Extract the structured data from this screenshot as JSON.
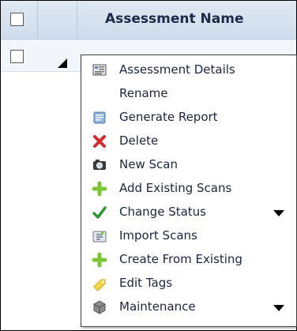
{
  "grid": {
    "header": {
      "column_name": "Assessment Name"
    }
  },
  "context_menu": {
    "items": [
      {
        "label": "Assessment Details",
        "icon": "assessment-details-icon",
        "submenu": false
      },
      {
        "label": "Rename",
        "icon": "",
        "submenu": false
      },
      {
        "label": "Generate Report",
        "icon": "report-icon",
        "submenu": false
      },
      {
        "label": "Delete",
        "icon": "delete-icon",
        "submenu": false
      },
      {
        "label": "New Scan",
        "icon": "scan-icon",
        "submenu": false
      },
      {
        "label": "Add Existing Scans",
        "icon": "plus-icon",
        "submenu": false
      },
      {
        "label": "Change Status",
        "icon": "checkmark-icon",
        "submenu": true
      },
      {
        "label": "Import Scans",
        "icon": "import-icon",
        "submenu": false
      },
      {
        "label": "Create From Existing",
        "icon": "plus-icon",
        "submenu": false
      },
      {
        "label": "Edit Tags",
        "icon": "tag-icon",
        "submenu": false
      },
      {
        "label": "Maintenance",
        "icon": "maintenance-icon",
        "submenu": true
      }
    ]
  },
  "colors": {
    "header_bg": "#d5e1ef",
    "text": "#1a2540",
    "delete_red": "#d42a2a",
    "check_green": "#2a9a2a",
    "plus_green": "#7cc832"
  }
}
